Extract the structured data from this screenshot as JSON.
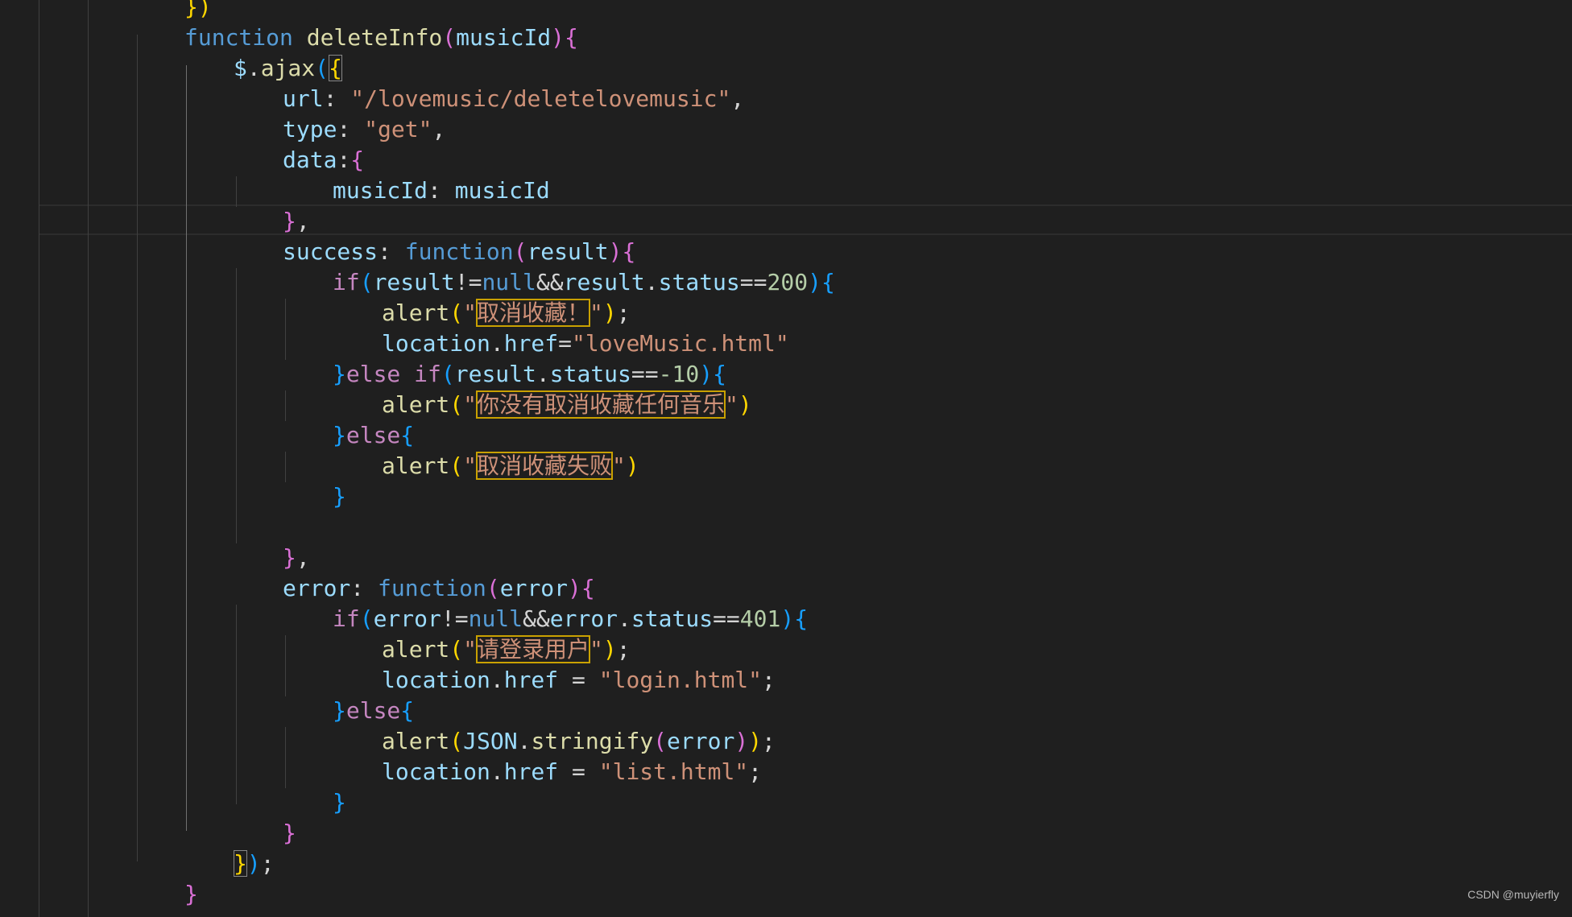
{
  "colors": {
    "background": "#1f1f1f",
    "keyword": "#569cd6",
    "control": "#c586c0",
    "function": "#dcdcaa",
    "variable": "#9cdcfe",
    "string": "#ce9178",
    "number": "#b5cea8",
    "plain": "#d4d4d4",
    "bracket1": "#ffd700",
    "bracket2": "#da70d6",
    "bracket3": "#179fff",
    "highlight_box": "#c9a100"
  },
  "code_lines": [
    [
      [
        "})",
        "#ffd700"
      ]
    ],
    [
      [
        "function ",
        "#569cd6"
      ],
      [
        "deleteInfo",
        "#dcdcaa"
      ],
      [
        "(",
        "#da70d6"
      ],
      [
        "musicId",
        "#9cdcfe"
      ],
      [
        ")",
        "#da70d6"
      ],
      [
        "{",
        "#da70d6"
      ]
    ],
    [
      [
        "$",
        "#9cdcfe"
      ],
      [
        ".",
        "#d4d4d4"
      ],
      [
        "ajax",
        "#dcdcaa"
      ],
      [
        "(",
        "#179fff"
      ],
      [
        "{",
        "#ffd700",
        "bm"
      ]
    ],
    [
      [
        "url",
        "#9cdcfe"
      ],
      [
        ": ",
        "#d4d4d4"
      ],
      [
        "\"/lovemusic/deletelovemusic\"",
        "#ce9178"
      ],
      [
        ",",
        "#d4d4d4"
      ]
    ],
    [
      [
        "type",
        "#9cdcfe"
      ],
      [
        ": ",
        "#d4d4d4"
      ],
      [
        "\"get\"",
        "#ce9178"
      ],
      [
        ",",
        "#d4d4d4"
      ]
    ],
    [
      [
        "data",
        "#9cdcfe"
      ],
      [
        ":",
        "#d4d4d4"
      ],
      [
        "{",
        "#da70d6"
      ]
    ],
    [
      [
        "musicId",
        "#9cdcfe"
      ],
      [
        ": ",
        "#d4d4d4"
      ],
      [
        "musicId",
        "#9cdcfe"
      ]
    ],
    [
      [
        "}",
        "#da70d6"
      ],
      [
        ",",
        "#d4d4d4"
      ]
    ],
    [
      [
        "success",
        "#9cdcfe"
      ],
      [
        ": ",
        "#d4d4d4"
      ],
      [
        "function",
        "#569cd6"
      ],
      [
        "(",
        "#da70d6"
      ],
      [
        "result",
        "#9cdcfe"
      ],
      [
        ")",
        "#da70d6"
      ],
      [
        "{",
        "#da70d6"
      ]
    ],
    [
      [
        "if",
        "#c586c0"
      ],
      [
        "(",
        "#179fff"
      ],
      [
        "result",
        "#9cdcfe"
      ],
      [
        "!=",
        "#d4d4d4"
      ],
      [
        "null",
        "#569cd6"
      ],
      [
        "&&",
        "#d4d4d4"
      ],
      [
        "result",
        "#9cdcfe"
      ],
      [
        ".",
        "#d4d4d4"
      ],
      [
        "status",
        "#9cdcfe"
      ],
      [
        "==",
        "#d4d4d4"
      ],
      [
        "200",
        "#b5cea8"
      ],
      [
        ")",
        "#179fff"
      ],
      [
        "{",
        "#179fff"
      ]
    ],
    [
      [
        "alert",
        "#dcdcaa"
      ],
      [
        "(",
        "#ffd700"
      ],
      [
        "\"",
        "#ce9178"
      ],
      [
        "取消收藏！",
        "#ce9178",
        "boxed"
      ],
      [
        "\"",
        "#ce9178"
      ],
      [
        ")",
        "#ffd700"
      ],
      [
        ";",
        "#d4d4d4"
      ]
    ],
    [
      [
        "location",
        "#9cdcfe"
      ],
      [
        ".",
        "#d4d4d4"
      ],
      [
        "href",
        "#9cdcfe"
      ],
      [
        "=",
        "#d4d4d4"
      ],
      [
        "\"loveMusic.html\"",
        "#ce9178"
      ]
    ],
    [
      [
        "}",
        "#179fff"
      ],
      [
        "else ",
        "#c586c0"
      ],
      [
        "if",
        "#c586c0"
      ],
      [
        "(",
        "#179fff"
      ],
      [
        "result",
        "#9cdcfe"
      ],
      [
        ".",
        "#d4d4d4"
      ],
      [
        "status",
        "#9cdcfe"
      ],
      [
        "==",
        "#d4d4d4"
      ],
      [
        "-10",
        "#b5cea8"
      ],
      [
        ")",
        "#179fff"
      ],
      [
        "{",
        "#179fff"
      ]
    ],
    [
      [
        "alert",
        "#dcdcaa"
      ],
      [
        "(",
        "#ffd700"
      ],
      [
        "\"",
        "#ce9178"
      ],
      [
        "你没有取消收藏任何音乐",
        "#ce9178",
        "boxed"
      ],
      [
        "\"",
        "#ce9178"
      ],
      [
        ")",
        "#ffd700"
      ]
    ],
    [
      [
        "}",
        "#179fff"
      ],
      [
        "else",
        "#c586c0"
      ],
      [
        "{",
        "#179fff"
      ]
    ],
    [
      [
        "alert",
        "#dcdcaa"
      ],
      [
        "(",
        "#ffd700"
      ],
      [
        "\"",
        "#ce9178"
      ],
      [
        "取消收藏失败",
        "#ce9178",
        "boxed"
      ],
      [
        "\"",
        "#ce9178"
      ],
      [
        ")",
        "#ffd700"
      ]
    ],
    [
      [
        "}",
        "#179fff"
      ]
    ],
    [],
    [
      [
        "}",
        "#da70d6"
      ],
      [
        ",",
        "#d4d4d4"
      ]
    ],
    [
      [
        "error",
        "#9cdcfe"
      ],
      [
        ": ",
        "#d4d4d4"
      ],
      [
        "function",
        "#569cd6"
      ],
      [
        "(",
        "#da70d6"
      ],
      [
        "error",
        "#9cdcfe"
      ],
      [
        ")",
        "#da70d6"
      ],
      [
        "{",
        "#da70d6"
      ]
    ],
    [
      [
        "if",
        "#c586c0"
      ],
      [
        "(",
        "#179fff"
      ],
      [
        "error",
        "#9cdcfe"
      ],
      [
        "!=",
        "#d4d4d4"
      ],
      [
        "null",
        "#569cd6"
      ],
      [
        "&&",
        "#d4d4d4"
      ],
      [
        "error",
        "#9cdcfe"
      ],
      [
        ".",
        "#d4d4d4"
      ],
      [
        "status",
        "#9cdcfe"
      ],
      [
        "==",
        "#d4d4d4"
      ],
      [
        "401",
        "#b5cea8"
      ],
      [
        ")",
        "#179fff"
      ],
      [
        "{",
        "#179fff"
      ]
    ],
    [
      [
        "alert",
        "#dcdcaa"
      ],
      [
        "(",
        "#ffd700"
      ],
      [
        "\"",
        "#ce9178"
      ],
      [
        "请登录用户",
        "#ce9178",
        "boxed"
      ],
      [
        "\"",
        "#ce9178"
      ],
      [
        ")",
        "#ffd700"
      ],
      [
        ";",
        "#d4d4d4"
      ]
    ],
    [
      [
        "location",
        "#9cdcfe"
      ],
      [
        ".",
        "#d4d4d4"
      ],
      [
        "href",
        "#9cdcfe"
      ],
      [
        " = ",
        "#d4d4d4"
      ],
      [
        "\"login.html\"",
        "#ce9178"
      ],
      [
        ";",
        "#d4d4d4"
      ]
    ],
    [
      [
        "}",
        "#179fff"
      ],
      [
        "else",
        "#c586c0"
      ],
      [
        "{",
        "#179fff"
      ]
    ],
    [
      [
        "alert",
        "#dcdcaa"
      ],
      [
        "(",
        "#ffd700"
      ],
      [
        "JSON",
        "#9cdcfe"
      ],
      [
        ".",
        "#d4d4d4"
      ],
      [
        "stringify",
        "#dcdcaa"
      ],
      [
        "(",
        "#da70d6"
      ],
      [
        "error",
        "#9cdcfe"
      ],
      [
        ")",
        "#da70d6"
      ],
      [
        ")",
        "#ffd700"
      ],
      [
        ";",
        "#d4d4d4"
      ]
    ],
    [
      [
        "location",
        "#9cdcfe"
      ],
      [
        ".",
        "#d4d4d4"
      ],
      [
        "href",
        "#9cdcfe"
      ],
      [
        " = ",
        "#d4d4d4"
      ],
      [
        "\"list.html\"",
        "#ce9178"
      ],
      [
        ";",
        "#d4d4d4"
      ]
    ],
    [
      [
        "}",
        "#179fff"
      ]
    ],
    [
      [
        "}",
        "#da70d6"
      ]
    ],
    [
      [
        "}",
        "#ffd700",
        "bm"
      ],
      [
        ")",
        "#179fff"
      ],
      [
        ";",
        "#d4d4d4"
      ]
    ],
    [
      [
        "}",
        "#da70d6"
      ]
    ]
  ],
  "watermark": "CSDN @muyierfly"
}
